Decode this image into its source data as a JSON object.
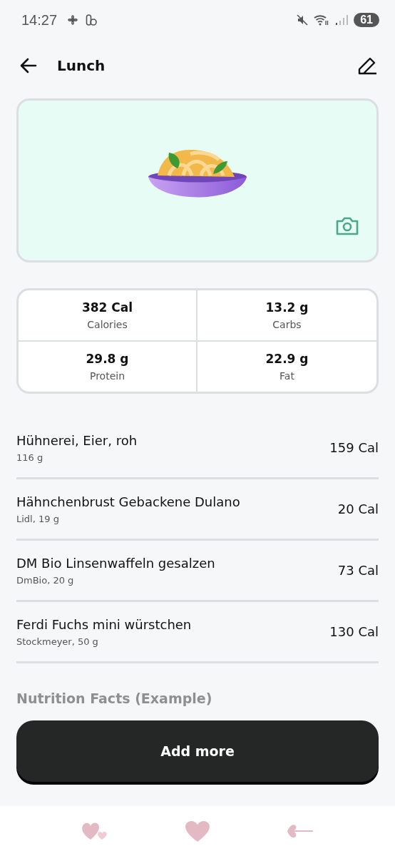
{
  "status_bar": {
    "time": "14:27",
    "battery": "61"
  },
  "header": {
    "title": "Lunch"
  },
  "macros": [
    {
      "value": "382 Cal",
      "label": "Calories"
    },
    {
      "value": "13.2 g",
      "label": "Carbs"
    },
    {
      "value": "29.8 g",
      "label": "Protein"
    },
    {
      "value": "22.9 g",
      "label": "Fat"
    }
  ],
  "foods": [
    {
      "name": "Hühnerei, Eier, roh",
      "detail": "116 g",
      "calories": "159 Cal"
    },
    {
      "name": "Hähnchenbrust Gebackene Dulano",
      "detail": "Lidl, 19 g",
      "calories": "20 Cal"
    },
    {
      "name": "DM Bio Linsenwaffeln gesalzen",
      "detail": "DmBio, 20 g",
      "calories": "73 Cal"
    },
    {
      "name": "Ferdi Fuchs mini würstchen",
      "detail": "Stockmeyer, 50 g",
      "calories": "130 Cal"
    }
  ],
  "section_title": "Nutrition Facts (Example)",
  "primary_button": "Add more"
}
